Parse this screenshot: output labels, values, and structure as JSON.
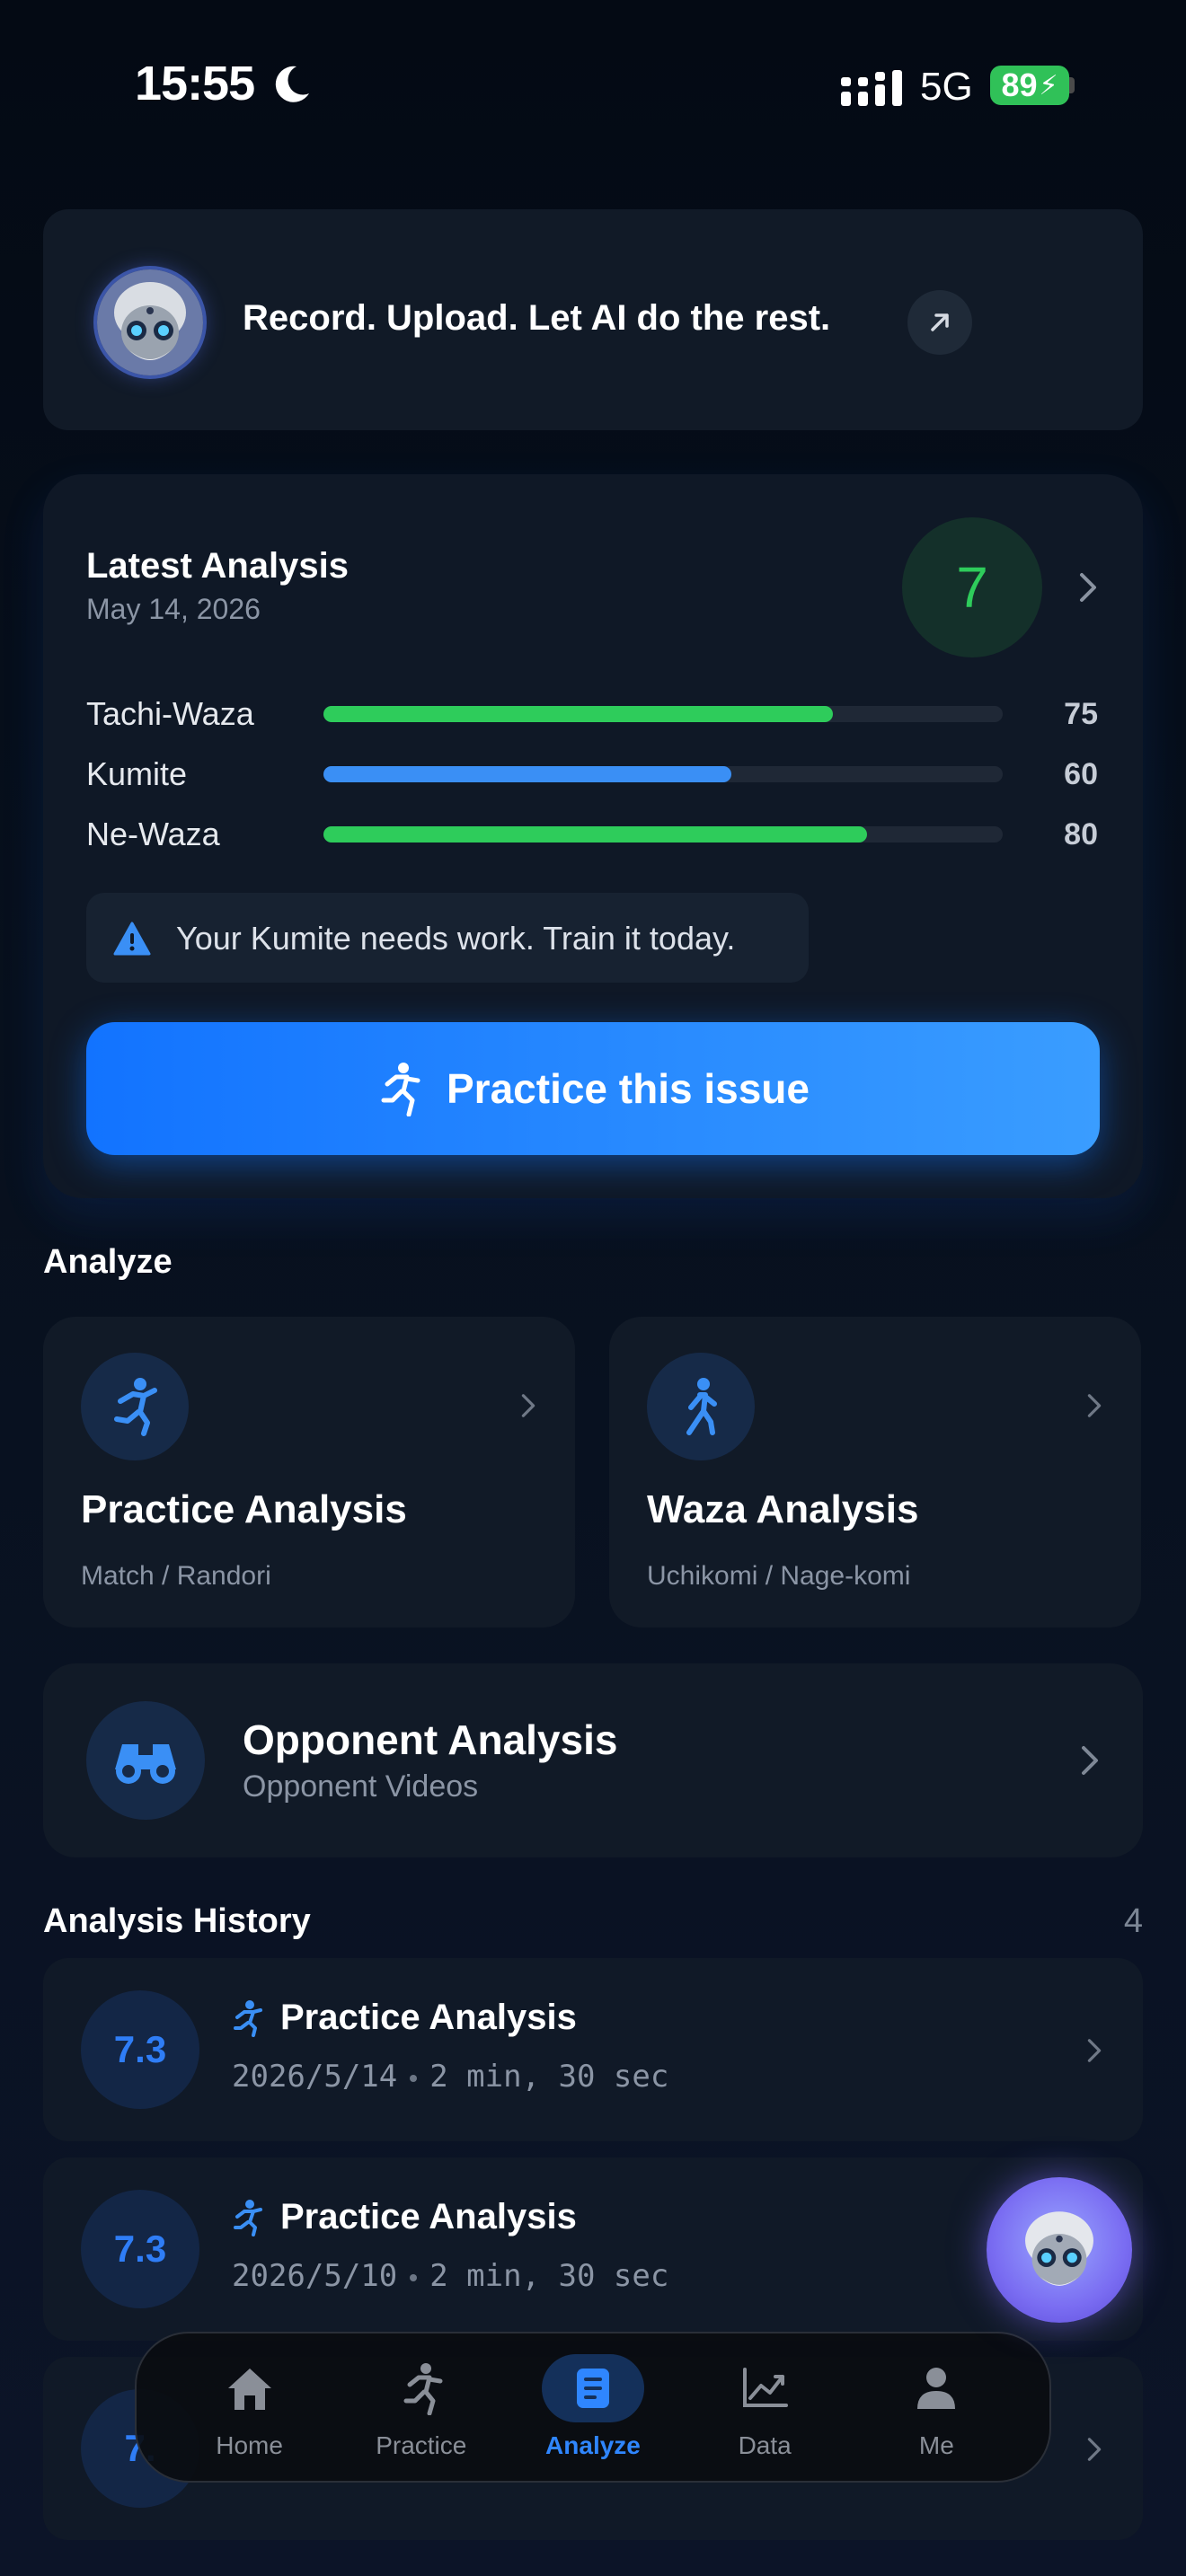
{
  "status_bar": {
    "time": "15:55",
    "network": "5G",
    "battery": "89"
  },
  "promo": {
    "text": "Record. Upload. Let AI do the rest."
  },
  "latest": {
    "title": "Latest Analysis",
    "date": "May 14, 2026",
    "score": "7",
    "bars": [
      {
        "label": "Tachi-Waza",
        "value": "75",
        "fraction": 0.75,
        "color": "#2ecc5b"
      },
      {
        "label": "Kumite",
        "value": "60",
        "fraction": 0.6,
        "color": "#3a8ff5"
      },
      {
        "label": "Ne-Waza",
        "value": "80",
        "fraction": 0.8,
        "color": "#2ecc5b"
      }
    ],
    "warning": "Your Kumite needs work. Train it today.",
    "cta_label": "Practice this issue"
  },
  "analyze": {
    "title": "Analyze",
    "tiles": [
      {
        "title": "Practice Analysis",
        "sub": "Match / Randori"
      },
      {
        "title": "Waza Analysis",
        "sub": "Uchikomi / Nage-komi"
      }
    ],
    "opponent": {
      "title": "Opponent Analysis",
      "sub": "Opponent Videos"
    }
  },
  "history": {
    "title": "Analysis History",
    "count": "4",
    "items": [
      {
        "score": "7.3",
        "name": "Practice Analysis",
        "date": "2026/5/14",
        "duration": "2 min, 30 sec"
      },
      {
        "score": "7.3",
        "name": "Practice Analysis",
        "date": "2026/5/10",
        "duration": "2 min, 30 sec"
      },
      {
        "score": "7.",
        "name": "",
        "date": "",
        "duration": ""
      }
    ]
  },
  "tabbar": {
    "tabs": [
      {
        "label": "Home",
        "icon": "home-icon"
      },
      {
        "label": "Practice",
        "icon": "practice-icon"
      },
      {
        "label": "Analyze",
        "icon": "analyze-icon",
        "active": true
      },
      {
        "label": "Data",
        "icon": "chart-icon"
      },
      {
        "label": "Me",
        "icon": "person-icon"
      }
    ]
  },
  "colors": {
    "accent": "#2f86ff",
    "green": "#2ecc5b",
    "card": "#111a27"
  }
}
